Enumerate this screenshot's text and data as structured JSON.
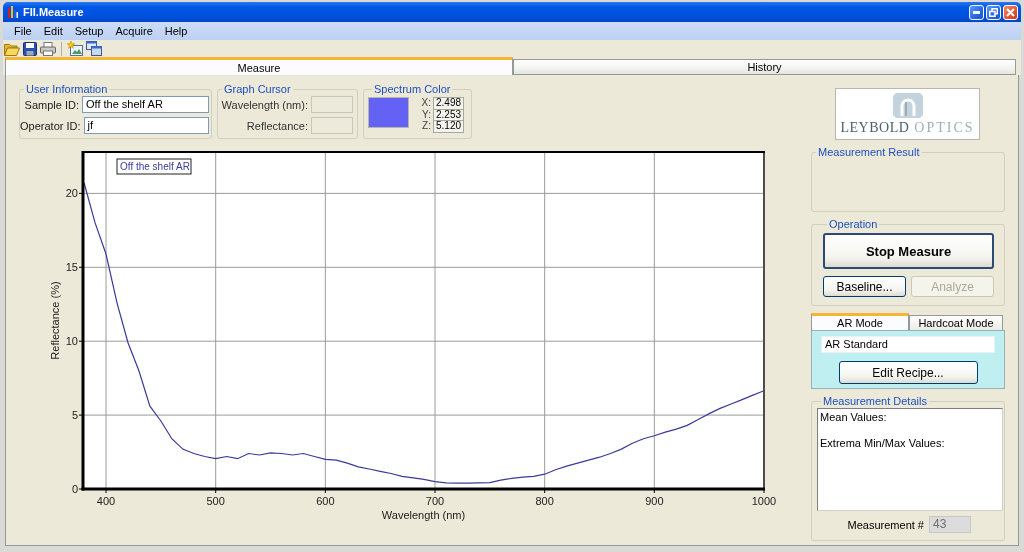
{
  "window": {
    "title": "FII.Measure"
  },
  "menu": [
    "File",
    "Edit",
    "Setup",
    "Acquire",
    "Help"
  ],
  "tabs": [
    {
      "label": "Measure",
      "selected": true
    },
    {
      "label": "History",
      "selected": false
    }
  ],
  "user_information": {
    "title": "User Information",
    "fields": [
      {
        "label": "Sample ID:",
        "value": "Off the shelf AR"
      },
      {
        "label": "Operator ID:",
        "value": "jf"
      }
    ]
  },
  "graph_cursor": {
    "title": "Graph Cursor",
    "fields": [
      {
        "label": "Wavelength (nm):",
        "disabled": true
      },
      {
        "label": "Reflectance:",
        "disabled": true
      }
    ]
  },
  "spectrum_color": {
    "title": "Spectrum Color",
    "color": "#6461f5",
    "coordinates": [
      {
        "label": "X:",
        "value": "2.498"
      },
      {
        "label": "Y:",
        "value": "2.253"
      },
      {
        "label": "Z:",
        "value": "5.120"
      }
    ]
  },
  "chart": {
    "chart_data": {
      "type": "line",
      "xlabel": "Wavelength (nm)",
      "ylabel": "Reflectance (%)",
      "x": [
        380,
        390,
        400,
        410,
        420,
        430,
        440,
        450,
        460,
        470,
        480,
        490,
        500,
        510,
        520,
        530,
        540,
        550,
        560,
        570,
        580,
        590,
        600,
        610,
        620,
        630,
        640,
        650,
        660,
        670,
        680,
        690,
        700,
        710,
        720,
        730,
        740,
        750,
        760,
        770,
        780,
        790,
        800,
        810,
        820,
        830,
        840,
        850,
        860,
        870,
        880,
        890,
        900,
        910,
        920,
        930,
        940,
        950,
        960,
        970,
        980,
        990,
        1000
      ],
      "series": [
        {
          "name": "Off the shelf AR",
          "color": "#3a3a9a",
          "values": [
            20.7,
            18.0,
            15.9,
            12.6,
            9.9,
            8.0,
            5.6,
            4.6,
            3.4,
            2.7,
            2.4,
            2.2,
            2.05,
            2.2,
            2.05,
            2.4,
            2.3,
            2.45,
            2.4,
            2.3,
            2.4,
            2.2,
            2.0,
            1.95,
            1.75,
            1.5,
            1.35,
            1.2,
            1.05,
            0.85,
            0.75,
            0.65,
            0.5,
            0.42,
            0.4,
            0.4,
            0.42,
            0.43,
            0.6,
            0.72,
            0.8,
            0.86,
            1.0,
            1.3,
            1.55,
            1.75,
            1.95,
            2.15,
            2.4,
            2.7,
            3.1,
            3.4,
            3.6,
            3.85,
            4.05,
            4.3,
            4.7,
            5.1,
            5.45,
            5.75,
            6.05,
            6.35,
            6.65
          ]
        }
      ],
      "xlim": [
        379,
        1000
      ],
      "ylim": [
        0,
        22.8
      ],
      "xticks": [
        400,
        500,
        600,
        700,
        800,
        900,
        1000
      ],
      "yticks": [
        0,
        5,
        10,
        15,
        20
      ],
      "grid": true
    }
  },
  "logo": {
    "words": [
      {
        "text": "LEYBOLD",
        "kind": "dark"
      },
      {
        "text": "OPTICS",
        "kind": "light"
      }
    ]
  },
  "measurement_result": {
    "title": "Measurement Result"
  },
  "operation": {
    "title": "Operation",
    "buttons": [
      {
        "label": "Stop Measure",
        "kind": "primary",
        "disabled": false
      },
      {
        "label": "Baseline...",
        "kind": "secondary",
        "disabled": false
      },
      {
        "label": "Analyze",
        "kind": "secondary",
        "disabled": true
      }
    ]
  },
  "mode_tabs": [
    {
      "label": "AR Mode",
      "selected": true
    },
    {
      "label": "Hardcoat Mode",
      "selected": false
    }
  ],
  "recipe": {
    "value": "AR Standard",
    "button": "Edit Recipe..."
  },
  "measurement_details": {
    "title": "Measurement Details",
    "lines": [
      "Mean Values:",
      "Extrema Min/Max Values:"
    ],
    "counter": {
      "label": "Measurement #",
      "value": "43",
      "disabled": true
    }
  }
}
